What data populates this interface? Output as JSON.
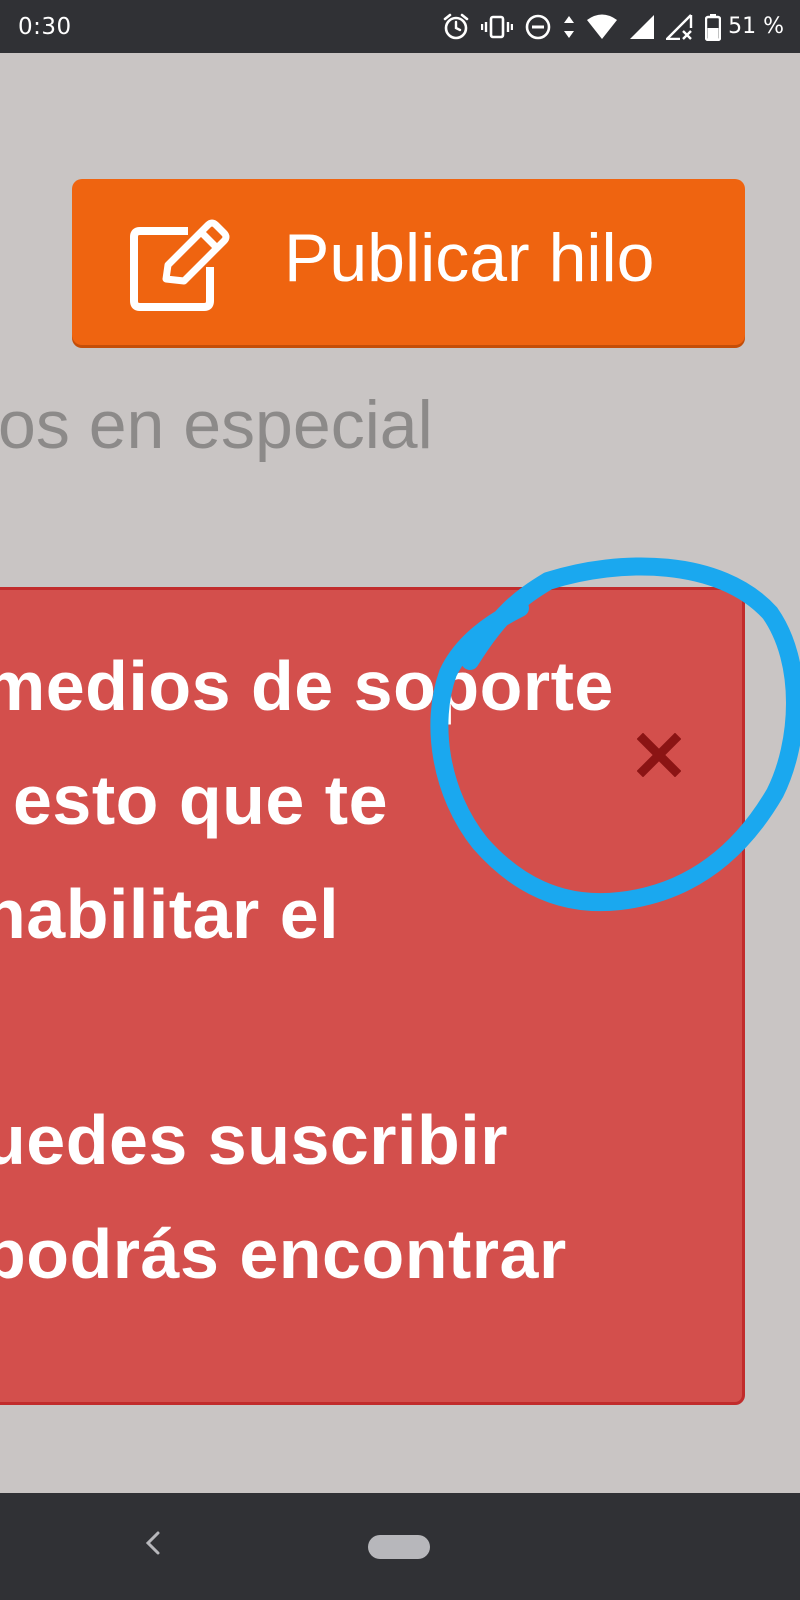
{
  "status_bar": {
    "time": "0:30",
    "battery": "51 %",
    "icons": [
      "alarm-icon",
      "vibrate-icon",
      "do-not-disturb-icon",
      "data-arrows-icon",
      "wifi-icon",
      "signal-icon",
      "signal-no-data-icon",
      "battery-icon"
    ]
  },
  "publish_button": {
    "label": "Publicar hilo",
    "icon": "edit-icon",
    "color": "#ef6410"
  },
  "section": {
    "text": "os en especial"
  },
  "alert": {
    "lines": [
      "medios de soporte",
      "esto que te",
      "habilitar el",
      "uedes suscribir",
      "podrás encontrar"
    ],
    "close_icon": "close-icon",
    "background": "#d34f4c",
    "close_color": "#8b1414"
  },
  "annotation": {
    "type": "circle",
    "color": "#1aa8ef"
  },
  "nav_bar": {
    "icons": [
      "back-icon",
      "home-pill-icon"
    ]
  }
}
